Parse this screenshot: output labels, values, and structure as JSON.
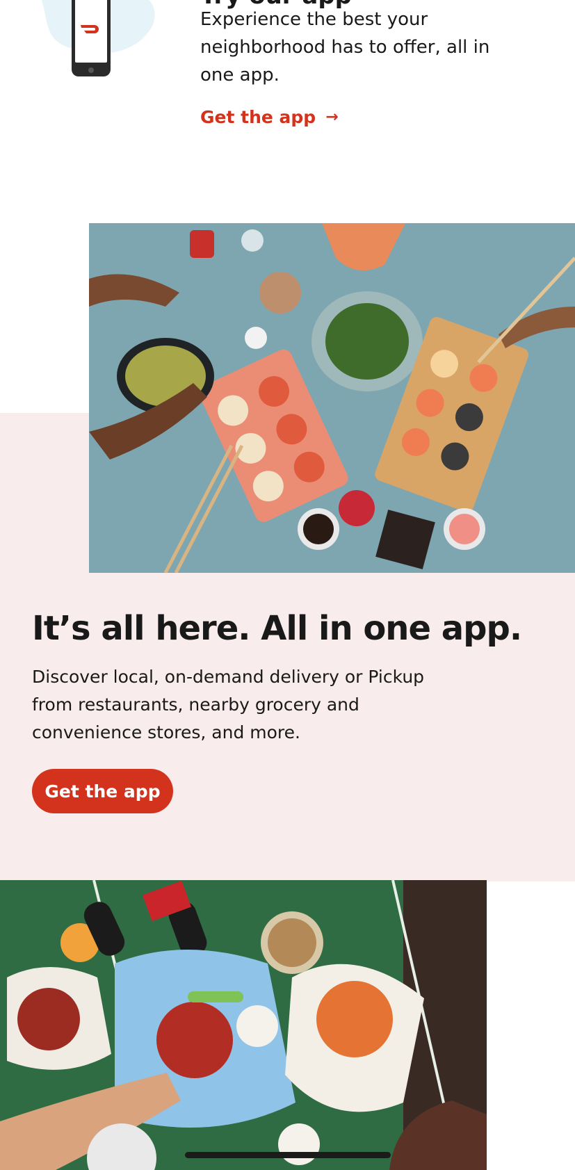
{
  "top": {
    "title": "Try our app",
    "description": "Experience the best your neighborhood has to offer, all in one app.",
    "link_label": "Get the app",
    "link_arrow": "→"
  },
  "hero": {
    "heading": "It’s all here. All in one app.",
    "description": "Discover local, on-demand delivery or Pickup from restaurants, nearby grocery and convenience stores, and more.",
    "button_label": "Get the app"
  },
  "colors": {
    "brand_red": "#d3331d",
    "pink_background": "#f9ecec",
    "text_dark": "#191919"
  }
}
